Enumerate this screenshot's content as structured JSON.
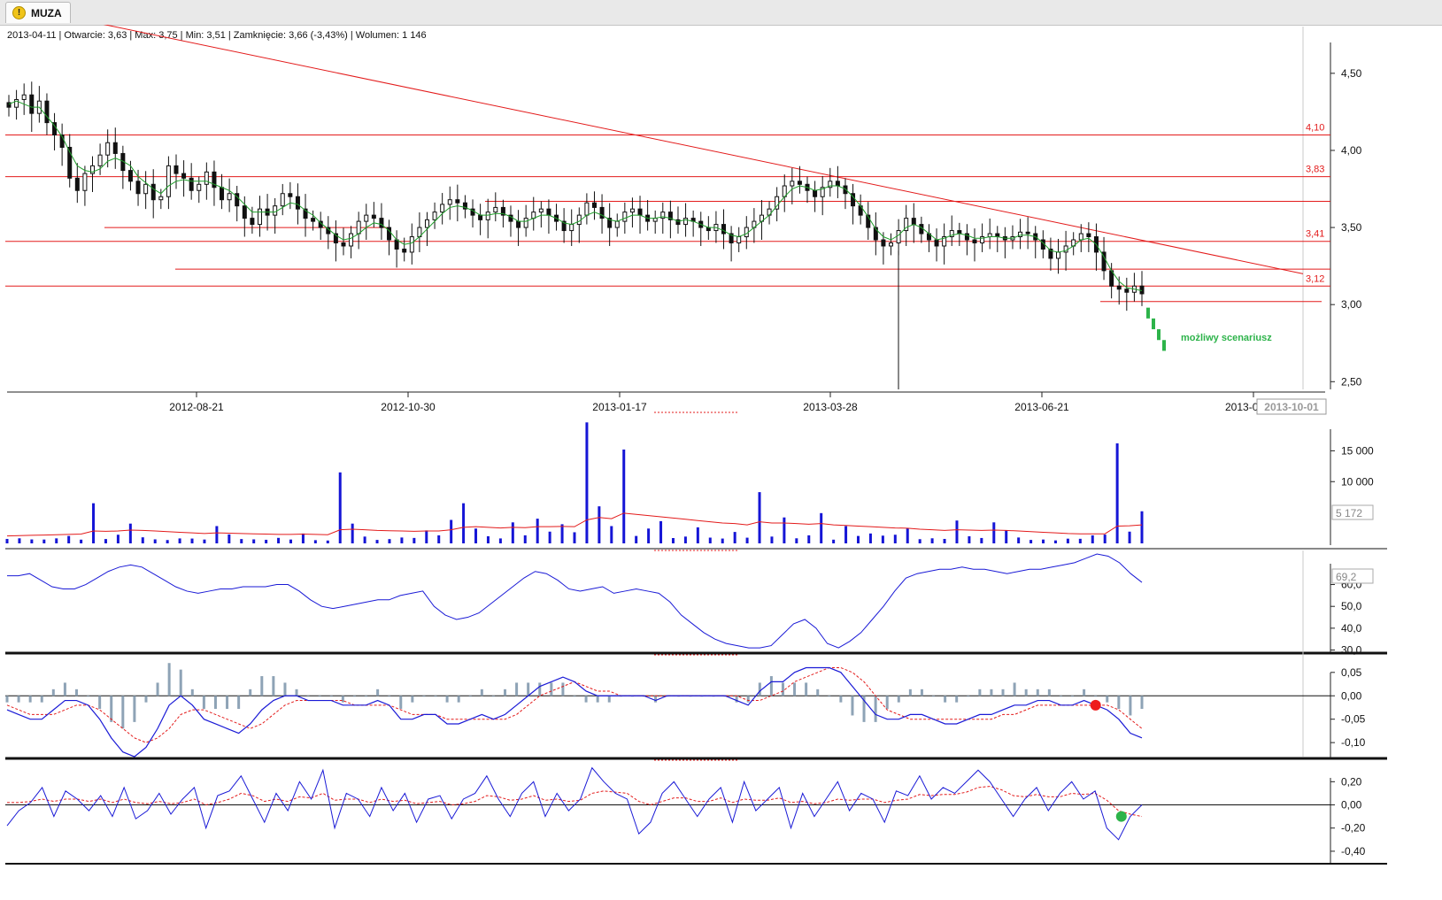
{
  "tab": {
    "label": "MUZA",
    "icon": "warning-icon"
  },
  "infobar": {
    "text": "2013-04-11 | Otwarcie: 3,63 | Max: 3,75 | Min: 3,51 | Zamknięcie: 3,66 (-3,43%)  | Wolumen: 1 146"
  },
  "chart_data": [
    {
      "type": "candlestick",
      "panel": "price",
      "x_ticks": [
        "2012-08-21",
        "2012-10-30",
        "2013-01-17",
        "2013-03-28",
        "2013-06-21",
        "2013-0"
      ],
      "cursor_date_label": "2013-10-01",
      "y_ticks": [
        "4,50",
        "4,00",
        "3,50",
        "3,00",
        "2,50"
      ],
      "ylim": [
        2.45,
        4.7
      ],
      "close": [
        4.28,
        4.33,
        4.36,
        4.24,
        4.32,
        4.18,
        4.1,
        4.02,
        3.82,
        3.74,
        3.85,
        3.9,
        3.97,
        4.05,
        3.98,
        3.87,
        3.8,
        3.72,
        3.78,
        3.68,
        3.7,
        3.9,
        3.85,
        3.82,
        3.74,
        3.78,
        3.86,
        3.76,
        3.68,
        3.72,
        3.64,
        3.56,
        3.52,
        3.62,
        3.58,
        3.64,
        3.72,
        3.7,
        3.62,
        3.56,
        3.54,
        3.5,
        3.46,
        3.4,
        3.38,
        3.46,
        3.54,
        3.58,
        3.56,
        3.5,
        3.42,
        3.36,
        3.34,
        3.44,
        3.5,
        3.55,
        3.6,
        3.65,
        3.68,
        3.66,
        3.62,
        3.58,
        3.55,
        3.6,
        3.63,
        3.58,
        3.54,
        3.5,
        3.56,
        3.6,
        3.62,
        3.58,
        3.54,
        3.48,
        3.52,
        3.58,
        3.66,
        3.63,
        3.56,
        3.5,
        3.54,
        3.6,
        3.62,
        3.58,
        3.54,
        3.56,
        3.6,
        3.55,
        3.52,
        3.56,
        3.54,
        3.5,
        3.48,
        3.52,
        3.46,
        3.4,
        3.44,
        3.5,
        3.54,
        3.58,
        3.62,
        3.7,
        3.77,
        3.8,
        3.78,
        3.74,
        3.7,
        3.76,
        3.8,
        3.77,
        3.72,
        3.64,
        3.58,
        3.5,
        3.42,
        3.38,
        3.4,
        3.48,
        3.56,
        3.52,
        3.46,
        3.42,
        3.38,
        3.44,
        3.48,
        3.46,
        3.42,
        3.4,
        3.44,
        3.46,
        3.44,
        3.42,
        3.44,
        3.47,
        3.46,
        3.42,
        3.36,
        3.3,
        3.34,
        3.38,
        3.42,
        3.46,
        3.44,
        3.34,
        3.22,
        3.12,
        3.1,
        3.08,
        3.12,
        3.07
      ],
      "sma": [
        4.3,
        4.32,
        4.3,
        4.28,
        4.28,
        4.22,
        4.16,
        4.09,
        3.99,
        3.9,
        3.87,
        3.86,
        3.88,
        3.93,
        3.95,
        3.93,
        3.9,
        3.83,
        3.79,
        3.75,
        3.72,
        3.77,
        3.8,
        3.81,
        3.8,
        3.8,
        3.8,
        3.78,
        3.76,
        3.74,
        3.7,
        3.65,
        3.6,
        3.6,
        3.6,
        3.6,
        3.63,
        3.66,
        3.65,
        3.61,
        3.58,
        3.53,
        3.49,
        3.45,
        3.42,
        3.43,
        3.46,
        3.5,
        3.53,
        3.52,
        3.48,
        3.42,
        3.39,
        3.4,
        3.44,
        3.49,
        3.54,
        3.59,
        3.63,
        3.64,
        3.63,
        3.61,
        3.58,
        3.58,
        3.59,
        3.59,
        3.57,
        3.54,
        3.54,
        3.56,
        3.58,
        3.58,
        3.56,
        3.53,
        3.52,
        3.54,
        3.58,
        3.6,
        3.58,
        3.55,
        3.54,
        3.56,
        3.58,
        3.58,
        3.56,
        3.56,
        3.57,
        3.56,
        3.54,
        3.55,
        3.54,
        3.52,
        3.5,
        3.5,
        3.48,
        3.45,
        3.44,
        3.46,
        3.5,
        3.54,
        3.58,
        3.64,
        3.7,
        3.75,
        3.77,
        3.76,
        3.74,
        3.75,
        3.77,
        3.77,
        3.75,
        3.7,
        3.64,
        3.57,
        3.49,
        3.44,
        3.42,
        3.45,
        3.5,
        3.52,
        3.5,
        3.46,
        3.42,
        3.43,
        3.45,
        3.46,
        3.45,
        3.43,
        3.43,
        3.44,
        3.44,
        3.43,
        3.43,
        3.45,
        3.45,
        3.44,
        3.4,
        3.35,
        3.34,
        3.35,
        3.38,
        3.42,
        3.43,
        3.39,
        3.31,
        3.22,
        3.15,
        3.11,
        3.1,
        3.09
      ],
      "support_resistance": [
        {
          "level": 4.1,
          "label": "4,10"
        },
        {
          "level": 3.83,
          "label": "3,83"
        },
        {
          "level": 3.67,
          "label": ""
        },
        {
          "level": 3.5,
          "label": ""
        },
        {
          "level": 3.41,
          "label": "3,41"
        },
        {
          "level": 3.23,
          "label": ""
        },
        {
          "level": 3.12,
          "label": "3,12"
        },
        {
          "level": 3.02,
          "label": ""
        }
      ],
      "trendline": {
        "from": 4.95,
        "to": 3.2
      },
      "scenario": {
        "label": "możliwy scenariusz",
        "values": [
          2.93,
          2.86,
          2.79,
          2.72
        ],
        "color": "#2db34a"
      },
      "colors": {
        "sr_line": "#e31b1b",
        "sma": "#1f9e2a",
        "candle": "#111111"
      }
    },
    {
      "type": "bar",
      "panel": "volume",
      "y_ticks": [
        "15 000",
        "10 000"
      ],
      "ylim": [
        0,
        19500
      ],
      "current_value_label": "5 172",
      "values": [
        720,
        820,
        640,
        620,
        810,
        1200,
        600,
        6500,
        700,
        1400,
        3200,
        980,
        650,
        540,
        800,
        780,
        620,
        2800,
        1450,
        700,
        650,
        580,
        890,
        620,
        1600,
        520,
        460,
        11500,
        3200,
        1100,
        560,
        690,
        950,
        880,
        2100,
        1300,
        3800,
        6500,
        2400,
        1150,
        800,
        3400,
        1300,
        4000,
        1900,
        3100,
        1800,
        19600,
        6000,
        2800,
        15200,
        1200,
        2400,
        3600,
        860,
        1100,
        2600,
        930,
        780,
        1850,
        920,
        8300,
        1100,
        4200,
        820,
        1300,
        4900,
        600,
        2800,
        1200,
        1600,
        1250,
        1400,
        2500,
        680,
        820,
        720,
        3700,
        1150,
        870,
        3400,
        2100,
        950,
        560,
        620,
        480,
        760,
        740,
        1300,
        1420,
        16200,
        1900,
        5200
      ],
      "ma": [
        1200,
        1250,
        1300,
        1350,
        1400,
        1450,
        1500,
        2000,
        1950,
        2000,
        2150,
        2100,
        2000,
        1900,
        1800,
        1700,
        1600,
        1700,
        1650,
        1600,
        1550,
        1500,
        1450,
        1450,
        1500,
        1450,
        1400,
        2200,
        2300,
        2200,
        2100,
        2050,
        2000,
        1950,
        2000,
        2000,
        2200,
        2600,
        2700,
        2600,
        2500,
        2600,
        2550,
        2700,
        2700,
        2750,
        2700,
        3800,
        4200,
        4000,
        4900,
        4700,
        4500,
        4300,
        4100,
        3900,
        3700,
        3500,
        3300,
        3200,
        3000,
        3500,
        3300,
        3300,
        3200,
        3100,
        3200,
        3000,
        2900,
        2800,
        2700,
        2600,
        2500,
        2450,
        2300,
        2200,
        2100,
        2200,
        2150,
        2100,
        2150,
        2100,
        2000,
        1900,
        1800,
        1700,
        1600,
        1550,
        1550,
        1550,
        2800,
        2850,
        3000
      ],
      "colors": {
        "bar": "#1515d6",
        "ma": "#e31b1b"
      }
    },
    {
      "type": "line",
      "panel": "rsi",
      "y_ticks": [
        "60,0",
        "50,0",
        "40,0",
        "30,0"
      ],
      "current_value_label": "69,2",
      "ylim": [
        29,
        74
      ],
      "values": [
        64,
        64,
        65,
        62,
        59,
        58,
        58,
        60,
        63,
        66,
        68,
        69,
        68,
        65,
        62,
        59,
        57,
        56,
        57,
        58,
        58,
        59,
        59,
        59,
        60,
        60,
        57,
        53,
        50,
        49,
        50,
        51,
        52,
        53,
        53,
        55,
        56,
        57,
        50,
        46,
        44,
        45,
        47,
        51,
        55,
        59,
        63,
        66,
        65,
        62,
        58,
        57,
        58,
        59,
        56,
        57,
        58,
        57,
        56,
        52,
        46,
        42,
        38,
        35,
        33,
        32,
        31,
        31,
        32,
        37,
        42,
        44,
        40,
        33,
        31,
        34,
        38,
        44,
        50,
        57,
        63,
        65,
        66,
        67,
        67,
        68,
        67,
        67,
        66,
        65,
        66,
        67,
        67,
        68,
        69,
        70,
        72,
        74,
        73,
        70,
        65,
        61
      ],
      "color": "#1a1ad6"
    },
    {
      "type": "line",
      "panel": "macd",
      "y_ticks": [
        "0,05",
        "0,00",
        "-0,05",
        "-0,10"
      ],
      "ylim": [
        -0.13,
        0.078
      ],
      "macd": [
        -0.03,
        -0.04,
        -0.05,
        -0.05,
        -0.03,
        -0.01,
        -0.01,
        -0.02,
        -0.05,
        -0.09,
        -0.12,
        -0.13,
        -0.11,
        -0.07,
        -0.02,
        0.0,
        -0.02,
        -0.05,
        -0.06,
        -0.07,
        -0.08,
        -0.06,
        -0.03,
        -0.01,
        0.0,
        0.0,
        -0.01,
        -0.01,
        -0.01,
        -0.02,
        -0.02,
        -0.02,
        -0.01,
        -0.02,
        -0.05,
        -0.05,
        -0.04,
        -0.04,
        -0.06,
        -0.06,
        -0.05,
        -0.04,
        -0.05,
        -0.04,
        -0.02,
        0.0,
        0.02,
        0.03,
        0.04,
        0.03,
        0.01,
        0.0,
        0.0,
        0.0,
        0.0,
        0.0,
        -0.01,
        0.0,
        0.0,
        0.0,
        0.0,
        0.0,
        0.0,
        -0.01,
        -0.02,
        0.01,
        0.03,
        0.03,
        0.05,
        0.06,
        0.06,
        0.06,
        0.05,
        0.02,
        -0.01,
        -0.04,
        -0.05,
        -0.05,
        -0.04,
        -0.04,
        -0.05,
        -0.06,
        -0.06,
        -0.05,
        -0.04,
        -0.04,
        -0.03,
        -0.02,
        -0.02,
        -0.01,
        -0.01,
        -0.02,
        -0.02,
        -0.01,
        -0.02,
        -0.03,
        -0.05,
        -0.08,
        -0.09
      ],
      "signal": [
        -0.02,
        -0.03,
        -0.04,
        -0.04,
        -0.04,
        -0.03,
        -0.02,
        -0.02,
        -0.03,
        -0.05,
        -0.07,
        -0.09,
        -0.1,
        -0.09,
        -0.07,
        -0.04,
        -0.03,
        -0.03,
        -0.04,
        -0.05,
        -0.06,
        -0.07,
        -0.06,
        -0.04,
        -0.02,
        -0.01,
        -0.01,
        -0.01,
        -0.01,
        -0.01,
        -0.02,
        -0.02,
        -0.02,
        -0.02,
        -0.03,
        -0.04,
        -0.04,
        -0.04,
        -0.05,
        -0.05,
        -0.05,
        -0.05,
        -0.05,
        -0.05,
        -0.04,
        -0.02,
        0.0,
        0.01,
        0.02,
        0.03,
        0.02,
        0.01,
        0.01,
        0.0,
        0.0,
        0.0,
        0.0,
        0.0,
        0.0,
        0.0,
        0.0,
        0.0,
        0.0,
        0.0,
        -0.01,
        -0.01,
        0.0,
        0.01,
        0.03,
        0.04,
        0.05,
        0.06,
        0.06,
        0.05,
        0.03,
        0.0,
        -0.03,
        -0.04,
        -0.05,
        -0.05,
        -0.05,
        -0.05,
        -0.05,
        -0.05,
        -0.05,
        -0.05,
        -0.04,
        -0.04,
        -0.03,
        -0.02,
        -0.02,
        -0.02,
        -0.02,
        -0.02,
        -0.02,
        -0.02,
        -0.03,
        -0.05,
        -0.07
      ],
      "marker": {
        "index": 94,
        "color": "#ee1c1c"
      },
      "colors": {
        "macd": "#1a1ad6",
        "signal": "#e31b1b",
        "hist": "#8ea3b6"
      }
    },
    {
      "type": "line",
      "panel": "oscillator",
      "y_ticks": [
        "0,20",
        "0,00",
        "-0,20",
        "-0,40"
      ],
      "ylim": [
        -0.5,
        0.34
      ],
      "values": [
        -0.18,
        -0.05,
        0.02,
        0.15,
        -0.1,
        0.12,
        0.05,
        -0.05,
        0.08,
        -0.1,
        0.15,
        -0.12,
        -0.05,
        0.1,
        -0.08,
        0.05,
        0.15,
        -0.2,
        0.08,
        0.12,
        0.25,
        0.05,
        -0.15,
        0.1,
        -0.05,
        0.2,
        0.05,
        0.3,
        -0.2,
        0.1,
        0.05,
        -0.1,
        0.15,
        -0.05,
        0.1,
        -0.15,
        0.05,
        0.08,
        -0.12,
        0.05,
        0.1,
        0.25,
        0.05,
        -0.1,
        0.1,
        0.2,
        -0.1,
        0.1,
        -0.05,
        0.05,
        0.32,
        0.2,
        0.1,
        0.05,
        -0.25,
        -0.15,
        0.1,
        0.2,
        0.05,
        -0.1,
        0.05,
        0.15,
        -0.15,
        0.2,
        -0.05,
        0.05,
        0.15,
        -0.2,
        0.1,
        -0.1,
        0.05,
        0.2,
        -0.05,
        0.1,
        0.05,
        -0.15,
        0.12,
        0.08,
        0.25,
        0.05,
        0.15,
        0.1,
        0.2,
        0.3,
        0.2,
        0.05,
        -0.1,
        0.05,
        0.15,
        -0.05,
        0.1,
        0.2,
        0.05,
        0.12,
        -0.2,
        -0.3,
        -0.1,
        0.0
      ],
      "signal": [
        0.02,
        0.02,
        0.03,
        0.05,
        0.03,
        0.05,
        0.05,
        0.03,
        0.05,
        0.02,
        0.05,
        0.02,
        0.01,
        0.03,
        0.01,
        0.02,
        0.05,
        0.0,
        0.02,
        0.05,
        0.1,
        0.08,
        0.03,
        0.05,
        0.03,
        0.07,
        0.06,
        0.1,
        0.04,
        0.05,
        0.05,
        0.02,
        0.05,
        0.03,
        0.04,
        0.01,
        0.02,
        0.03,
        0.0,
        0.01,
        0.03,
        0.08,
        0.07,
        0.04,
        0.05,
        0.08,
        0.04,
        0.05,
        0.03,
        0.04,
        0.1,
        0.12,
        0.11,
        0.1,
        0.03,
        0.0,
        0.03,
        0.06,
        0.06,
        0.03,
        0.03,
        0.06,
        0.02,
        0.05,
        0.04,
        0.04,
        0.06,
        0.02,
        0.03,
        0.01,
        0.02,
        0.05,
        0.04,
        0.05,
        0.05,
        0.02,
        0.04,
        0.05,
        0.09,
        0.08,
        0.09,
        0.09,
        0.11,
        0.15,
        0.16,
        0.13,
        0.08,
        0.07,
        0.09,
        0.07,
        0.07,
        0.1,
        0.09,
        0.1,
        0.04,
        -0.05,
        -0.08,
        -0.1
      ],
      "marker": {
        "index": 96,
        "color": "#2db34a"
      },
      "colors": {
        "line": "#1a1ad6",
        "signal": "#e31b1b"
      }
    }
  ]
}
